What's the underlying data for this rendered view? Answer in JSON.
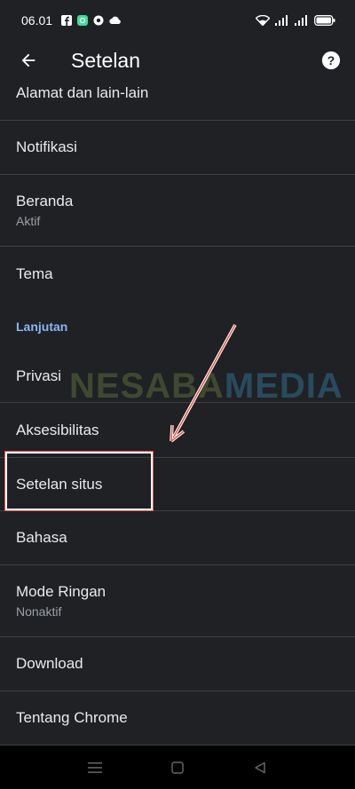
{
  "status_bar": {
    "time": "06.01",
    "left_icons": [
      "facebook-icon",
      "app-icon",
      "chrome-icon",
      "cloud-icon"
    ],
    "right_icons": [
      "wifi-icon",
      "signal-icon",
      "signal-icon",
      "battery-icon"
    ]
  },
  "toolbar": {
    "back_icon": "arrow-back-icon",
    "title": "Setelan",
    "help_icon": "help-icon"
  },
  "settings": [
    {
      "title": "Alamat dan lain-lain"
    },
    {
      "title": "Notifikasi"
    },
    {
      "title": "Beranda",
      "summary": "Aktif"
    },
    {
      "title": "Tema"
    },
    {
      "section_header": "Lanjutan"
    },
    {
      "title": "Privasi"
    },
    {
      "title": "Aksesibilitas"
    },
    {
      "title": "Setelan situs"
    },
    {
      "title": "Bahasa"
    },
    {
      "title": "Mode Ringan",
      "summary": "Nonaktif"
    },
    {
      "title": "Download"
    },
    {
      "title": "Tentang Chrome"
    }
  ],
  "watermark": {
    "part1": "NESABA",
    "part2": "MEDIA"
  },
  "annotation": {
    "highlighted_item": "Setelan situs",
    "arrow_color": "#e05a4a"
  },
  "nav_bar": {
    "icons": [
      "menu-icon",
      "home-icon",
      "back-triangle-icon"
    ]
  },
  "colors": {
    "background": "#202124",
    "accent": "#8ab4f8",
    "divider": "#3c4043"
  }
}
